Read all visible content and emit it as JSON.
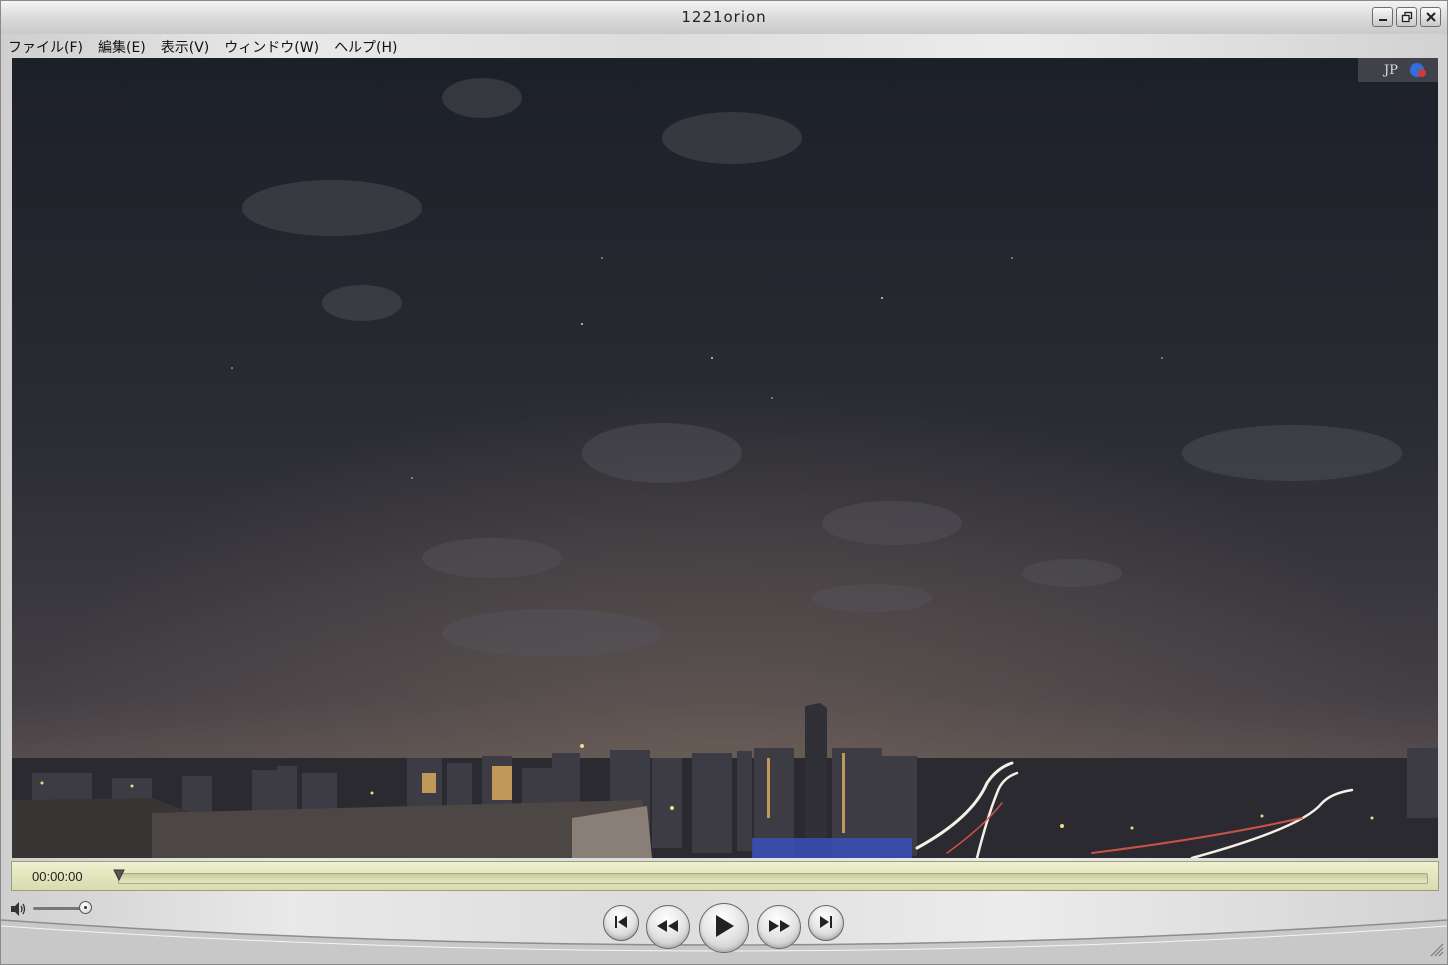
{
  "window": {
    "title": "1221orion"
  },
  "menu": {
    "items": [
      "ファイル(F)",
      "編集(E)",
      "表示(V)",
      "ウィンドウ(W)",
      "ヘルプ(H)"
    ]
  },
  "video": {
    "overlay_label": "JP"
  },
  "timeline": {
    "current_time": "00:00:00",
    "progress": 0
  },
  "volume": {
    "level": 1.0
  },
  "icons": {
    "minimize": "minimize-icon",
    "restore": "restore-icon",
    "close": "close-icon",
    "speaker": "speaker-icon",
    "skip_back": "skip-to-start-icon",
    "rewind": "rewind-icon",
    "play": "play-icon",
    "fast_forward": "fast-forward-icon",
    "skip_forward": "skip-to-end-icon"
  },
  "colors": {
    "timebar": "#e2e5bd",
    "window_chrome": "#dcdcdc"
  }
}
